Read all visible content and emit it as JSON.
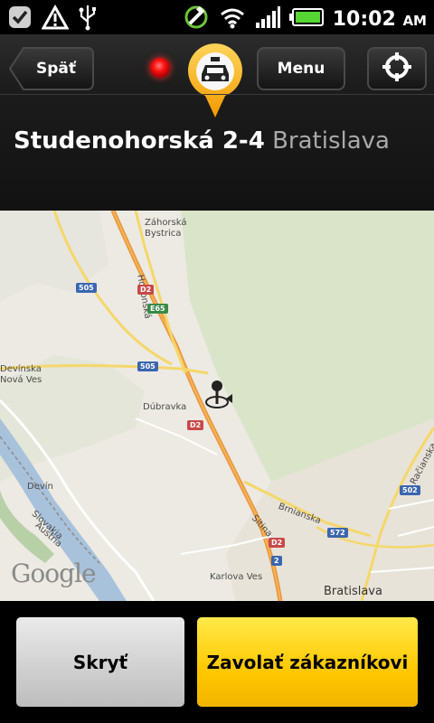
{
  "status_bar": {
    "time": "10:02",
    "ampm": "AM"
  },
  "header": {
    "back_label": "Späť",
    "menu_label": "Menu",
    "address_street": "Studenohorská 2-4",
    "address_city": "Bratislava"
  },
  "map": {
    "labels": {
      "zahorska_bystrica": "Záhorská\nBystrica",
      "hodonska": "Hodonská",
      "devinska_nova_ves": "Devínska\nNová Ves",
      "dubravka": "Dúbravka",
      "devin": "Devín",
      "slovakia": "Slovakia",
      "austria": "Austria",
      "karlova_ves": "Karlova Ves",
      "bratislava": "Bratislava",
      "brnianska": "Brnianska",
      "sitina": "Sitina",
      "racianska": "Račianska"
    },
    "shields": {
      "r505a": "505",
      "r505b": "505",
      "d2a": "D2",
      "d2b": "D2",
      "d2c": "D2",
      "e65": "E65",
      "r502": "502",
      "r572": "572",
      "r2": "2"
    },
    "attribution": "Google"
  },
  "buttons": {
    "hide_label": "Skryť",
    "call_label": "Zavolať zákazníkovi"
  },
  "colors": {
    "accent_yellow": "#ffc800",
    "led_red": "#ff1010",
    "map_background": "#eceae3"
  },
  "icons": {
    "checkmark": "check-notification-icon",
    "warning": "warning-icon",
    "usb": "usb-icon",
    "gps": "gps-satellite-icon",
    "wifi": "wifi-icon",
    "signal": "signal-icon",
    "battery": "battery-icon",
    "taxi": "taxi-pin-icon",
    "locate": "crosshair-icon",
    "map_marker": "map-marker-icon"
  }
}
